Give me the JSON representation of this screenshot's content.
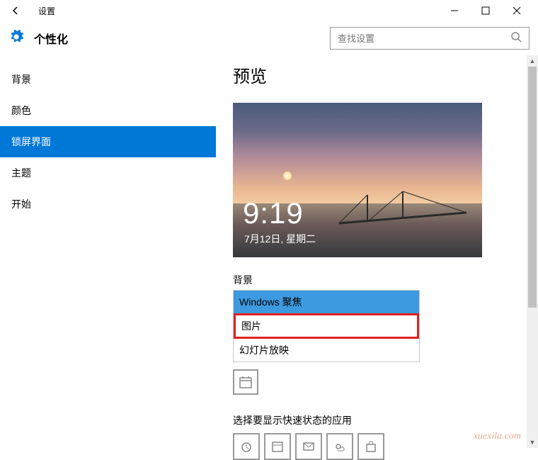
{
  "window": {
    "title": "设置"
  },
  "header": {
    "title": "个性化",
    "search_placeholder": "查找设置"
  },
  "sidebar": {
    "items": [
      {
        "label": "背景",
        "active": false
      },
      {
        "label": "颜色",
        "active": false
      },
      {
        "label": "锁屏界面",
        "active": true
      },
      {
        "label": "主题",
        "active": false
      },
      {
        "label": "开始",
        "active": false
      }
    ]
  },
  "main": {
    "heading": "预览",
    "lock_time": "9:19",
    "lock_date": "7月12日, 星期二",
    "bg_label": "背景",
    "bg_options": [
      {
        "label": "Windows 聚焦",
        "selected": true,
        "highlighted": false
      },
      {
        "label": "图片",
        "selected": false,
        "highlighted": true
      },
      {
        "label": "幻灯片放映",
        "selected": false,
        "highlighted": false
      }
    ],
    "quick_label": "选择要显示快速状态的应用"
  },
  "watermark": "xuexila.com"
}
